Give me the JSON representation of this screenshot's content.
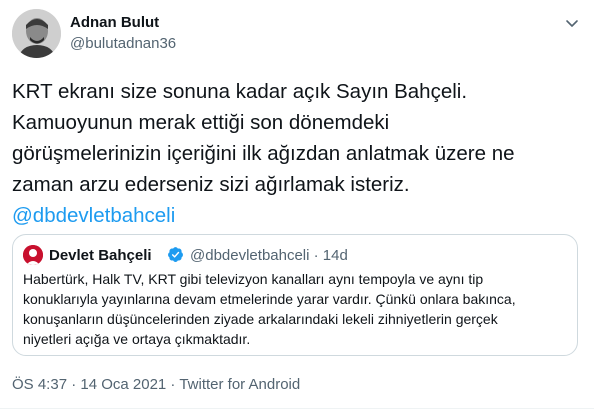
{
  "tweet": {
    "author_name": "Adnan Bulut",
    "author_handle": "@bulutadnan36",
    "text_lines": [
      "KRT ekranı size sonuna kadar açık Sayın Bahçeli.",
      "Kamuoyunun merak ettiği son dönemdeki",
      "görüşmelerinizin içeriğini ilk ağızdan anlatmak üzere ne",
      "zaman arzu ederseniz sizi ağırlamak isteriz."
    ],
    "mention": "@dbdevletbahceli",
    "timestamp": "ÖS 4:37 · 14 Oca 2021 · Twitter for Android"
  },
  "quoted": {
    "author_name": "Devlet Bahçeli",
    "author_handle": "@dbdevletbahceli · 14d",
    "text_lines": [
      "Habertürk, Halk TV, KRT gibi televizyon kanalları aynı tempoyla ve aynı tip",
      "konuklarıyla yayınlarına devam etmelerinde yarar vardır. Çünkü onlara bakınca,",
      "konuşanların düşüncelerinden ziyade arkalarındaki lekeli zihniyetlerin gerçek",
      "niyetleri açığa ve ortaya çıkmaktadır."
    ]
  },
  "icons": {
    "more": "chevron-down-icon",
    "verified": "verified-badge-icon"
  },
  "colors": {
    "link": "#1d9bf0",
    "secondary_text": "#536471",
    "border": "#cfd9de"
  }
}
